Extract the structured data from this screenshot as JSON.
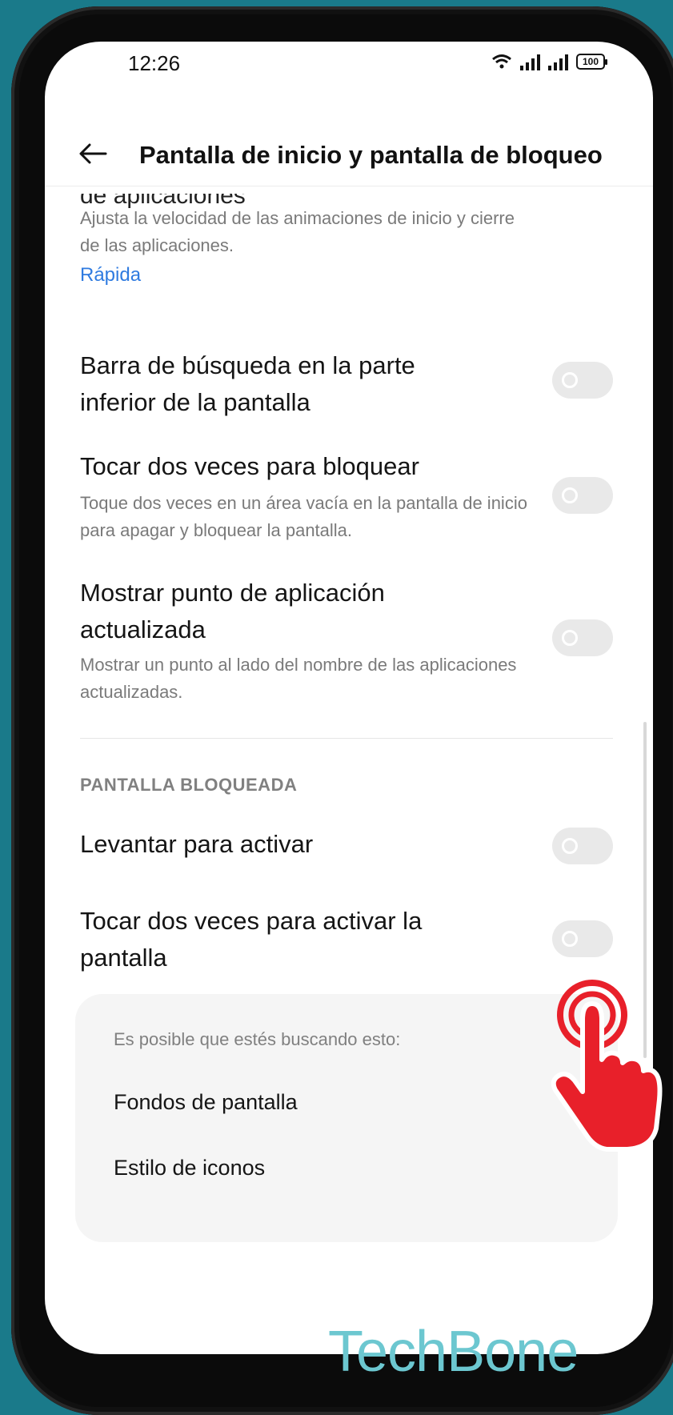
{
  "status_bar": {
    "time": "12:26",
    "battery": "100"
  },
  "header": {
    "title": "Pantalla de inicio y pantalla de bloqueo"
  },
  "animation_speed": {
    "title_partial": "de aplicaciones",
    "description": "Ajusta la velocidad de las animaciones de inicio y cierre de las aplicaciones.",
    "value": "Rápida"
  },
  "settings": [
    {
      "title": "Barra de búsqueda en la parte inferior de la pantalla",
      "description": "",
      "enabled": false
    },
    {
      "title": "Tocar dos veces para bloquear",
      "description": "Toque dos veces en un área vacía en la pantalla de inicio para apagar y bloquear la pantalla.",
      "enabled": false
    },
    {
      "title": "Mostrar punto de aplicación actualizada",
      "description": "Mostrar un punto al lado del nombre de las aplicaciones actualizadas.",
      "enabled": false
    }
  ],
  "lock_section": {
    "header": "PANTALLA BLOQUEADA",
    "items": [
      {
        "title": "Levantar para activar",
        "enabled": false
      },
      {
        "title": "Tocar dos veces para activar la pantalla",
        "enabled": false
      }
    ]
  },
  "suggestions": {
    "header": "Es posible que estés buscando esto:",
    "items": [
      "Fondos de pantalla",
      "Estilo de iconos"
    ]
  },
  "watermark": "TechBone",
  "colors": {
    "background": "#1a7a8a",
    "link": "#2f7be0",
    "toggle_off": "#e9e9e9",
    "tap_indicator": "#e8202a"
  }
}
